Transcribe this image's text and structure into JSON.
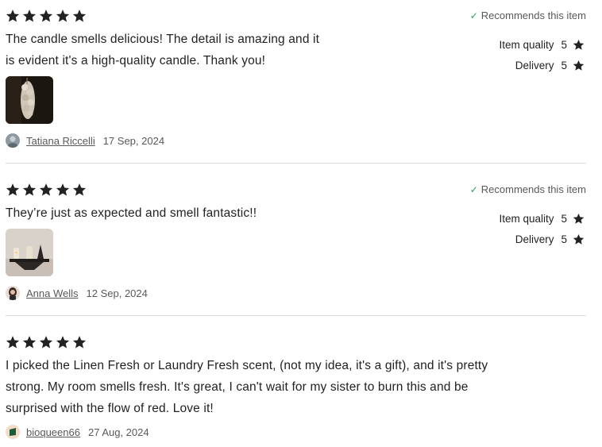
{
  "reviews": [
    {
      "rating": 5,
      "text": "The candle smells delicious! The detail is amazing and it\nis evident it's a high-quality candle. Thank you!",
      "recommend_label": "Recommends this item",
      "item_quality_label": "Item quality",
      "item_quality_value": "5",
      "delivery_label": "Delivery",
      "delivery_value": "5",
      "author": "Tatiana Riccelli",
      "date": "17 Sep, 2024"
    },
    {
      "rating": 5,
      "text": "They’re just as expected and smell fantastic!!",
      "recommend_label": "Recommends this item",
      "item_quality_label": "Item quality",
      "item_quality_value": "5",
      "delivery_label": "Delivery",
      "delivery_value": "5",
      "author": "Anna Wells",
      "date": "12 Sep, 2024"
    },
    {
      "rating": 5,
      "text": "I picked the Linen Fresh or Laundry Fresh scent, (not my idea, it's a gift), and it's pretty\nstrong. My room smells fresh. It's great, I can't wait for my sister to burn this and be\nsurprised with the flow of red. Love it!",
      "author": "bioqueen66",
      "date": "27 Aug, 2024"
    }
  ],
  "icons": {
    "star": "star-icon",
    "check": "checkmark-icon"
  },
  "colors": {
    "text": "#222222",
    "muted": "#595959",
    "check": "#2f9f5f",
    "divider": "#dddddd"
  }
}
